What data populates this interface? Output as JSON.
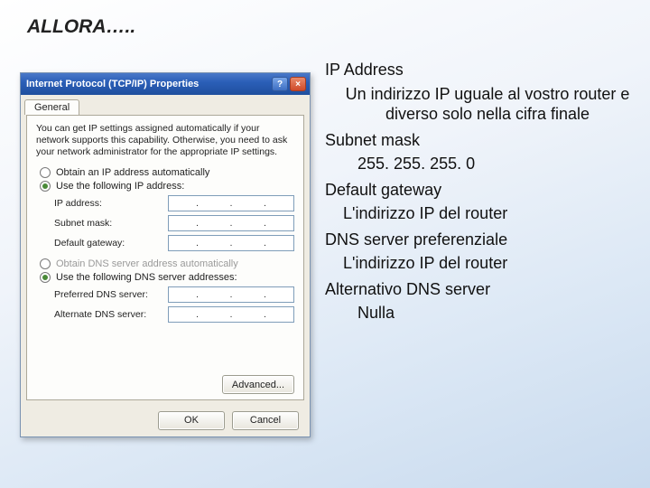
{
  "slide": {
    "title": "ALLORA….."
  },
  "right": {
    "ip_hdr": "IP Address",
    "ip_body": "Un indirizzo IP uguale al vostro router e diverso solo nella cifra finale",
    "subnet_hdr": "Subnet mask",
    "subnet_body": "255. 255. 255. 0",
    "gw_hdr": "Default gateway",
    "gw_body": "L'indirizzo IP del router",
    "dns1_hdr": "DNS server preferenziale",
    "dns1_body": "L'indirizzo IP del router",
    "dns2_hdr": "Alternativo DNS server",
    "dns2_body": "Nulla"
  },
  "dialog": {
    "title": "Internet Protocol (TCP/IP) Properties",
    "help_btn": "?",
    "close_btn": "×",
    "tab": "General",
    "desc": "You can get IP settings assigned automatically if your network supports this capability. Otherwise, you need to ask your network administrator for the appropriate IP settings.",
    "r_auto_ip": "Obtain an IP address automatically",
    "r_use_ip": "Use the following IP address:",
    "lbl_ip": "IP address:",
    "lbl_subnet": "Subnet mask:",
    "lbl_gateway": "Default gateway:",
    "r_auto_dns": "Obtain DNS server address automatically",
    "r_use_dns": "Use the following DNS server addresses:",
    "lbl_pref_dns": "Preferred DNS server:",
    "lbl_alt_dns": "Alternate DNS server:",
    "btn_advanced": "Advanced...",
    "btn_ok": "OK",
    "btn_cancel": "Cancel"
  }
}
